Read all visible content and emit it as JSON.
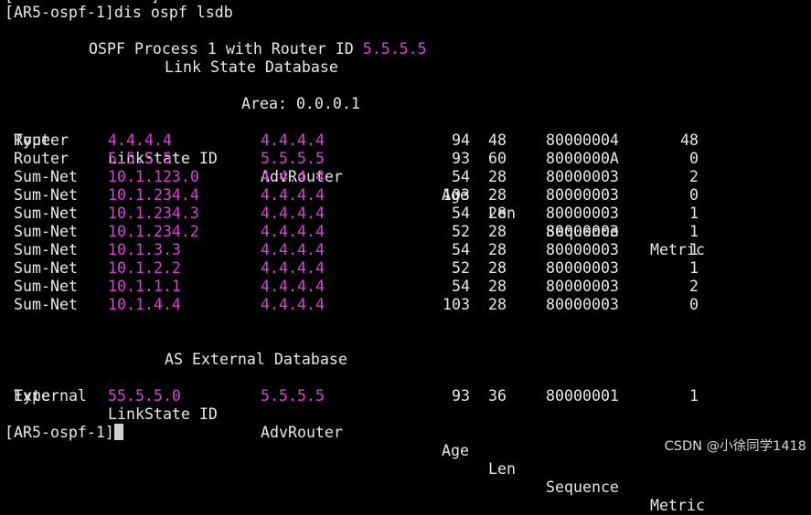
{
  "terminal": {
    "command_line": "[AR5-ospf-1]dis ospf lsdb",
    "process_header_prefix": "OSPF Process 1 with Router ID ",
    "router_id": "5.5.5.5",
    "lsdb_title": "Link State Database",
    "area_label": "Area: 0.0.0.1",
    "columns": {
      "type": "Type",
      "link_state_id": "LinkState ID",
      "adv_router": "AdvRouter",
      "age": "Age",
      "len": "Len",
      "sequence": "Sequence",
      "metric": "Metric"
    },
    "area_rows": [
      {
        "type": "Router",
        "link_state_id": "4.4.4.4",
        "adv_router": "4.4.4.4",
        "age": "94",
        "len": "48",
        "sequence": "80000004",
        "metric": "48"
      },
      {
        "type": "Router",
        "link_state_id": "5.5.5.5",
        "adv_router": "5.5.5.5",
        "age": "93",
        "len": "60",
        "sequence": "8000000A",
        "metric": "0"
      },
      {
        "type": "Sum-Net",
        "link_state_id": "10.1.123.0",
        "adv_router": "4.4.4.4",
        "age": "54",
        "len": "28",
        "sequence": "80000003",
        "metric": "2"
      },
      {
        "type": "Sum-Net",
        "link_state_id": "10.1.234.4",
        "adv_router": "4.4.4.4",
        "age": "103",
        "len": "28",
        "sequence": "80000003",
        "metric": "0"
      },
      {
        "type": "Sum-Net",
        "link_state_id": "10.1.234.3",
        "adv_router": "4.4.4.4",
        "age": "54",
        "len": "28",
        "sequence": "80000003",
        "metric": "1"
      },
      {
        "type": "Sum-Net",
        "link_state_id": "10.1.234.2",
        "adv_router": "4.4.4.4",
        "age": "52",
        "len": "28",
        "sequence": "80000003",
        "metric": "1"
      },
      {
        "type": "Sum-Net",
        "link_state_id": "10.1.3.3",
        "adv_router": "4.4.4.4",
        "age": "54",
        "len": "28",
        "sequence": "80000003",
        "metric": "1"
      },
      {
        "type": "Sum-Net",
        "link_state_id": "10.1.2.2",
        "adv_router": "4.4.4.4",
        "age": "52",
        "len": "28",
        "sequence": "80000003",
        "metric": "1"
      },
      {
        "type": "Sum-Net",
        "link_state_id": "10.1.1.1",
        "adv_router": "4.4.4.4",
        "age": "54",
        "len": "28",
        "sequence": "80000003",
        "metric": "2"
      },
      {
        "type": "Sum-Net",
        "link_state_id": "10.1.4.4",
        "adv_router": "4.4.4.4",
        "age": "103",
        "len": "28",
        "sequence": "80000003",
        "metric": "0"
      }
    ],
    "external_title": "AS External Database",
    "external_rows": [
      {
        "type": "External",
        "link_state_id": "55.5.5.0",
        "adv_router": "5.5.5.5",
        "age": "93",
        "len": "36",
        "sequence": "80000001",
        "metric": "1"
      }
    ],
    "prompt": "[AR5-ospf-1]"
  },
  "watermark": "CSDN @小徐同学1418",
  "colors": {
    "background": "#000000",
    "text": "#e8e8e8",
    "highlight": "#e23ce0"
  }
}
